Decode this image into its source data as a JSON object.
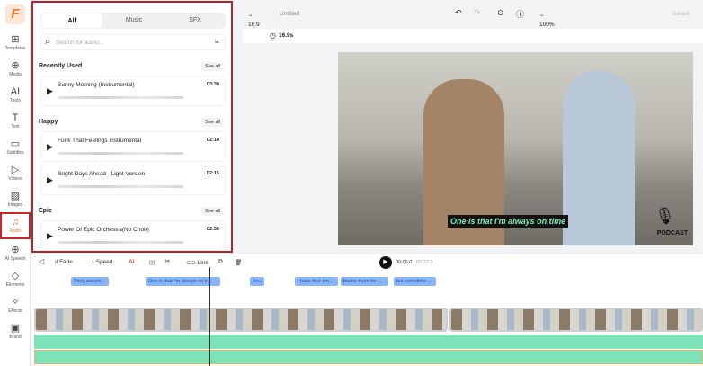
{
  "rail": {
    "logo": "F",
    "items": [
      {
        "label": "Templates",
        "icon": "⊞"
      },
      {
        "label": "Media",
        "icon": "⊕"
      },
      {
        "label": "Tools",
        "icon": "AI"
      },
      {
        "label": "Text",
        "icon": "T"
      },
      {
        "label": "Subtitles",
        "icon": "▭"
      },
      {
        "label": "Videos",
        "icon": "▷"
      },
      {
        "label": "Images",
        "icon": "▨"
      },
      {
        "label": "Audio",
        "icon": "♫"
      },
      {
        "label": "AI Speech",
        "icon": "⊕"
      },
      {
        "label": "Elements",
        "icon": "◇"
      },
      {
        "label": "Effects",
        "icon": "✧"
      },
      {
        "label": "Brand",
        "icon": "▣"
      }
    ]
  },
  "panel": {
    "tabs": [
      "All",
      "Music",
      "SFX"
    ],
    "search_placeholder": "Search for audio...",
    "see_all": "See all",
    "sections": [
      {
        "title": "Recently Used",
        "tracks": [
          {
            "name": "Sunny Morning (Instrumental)",
            "duration": "03:38"
          }
        ]
      },
      {
        "title": "Happy",
        "tracks": [
          {
            "name": "Funk That Feelings Instrumental",
            "duration": "02:10"
          },
          {
            "name": "Bright Days Ahead - Light Version",
            "duration": "02:15"
          }
        ]
      },
      {
        "title": "Epic",
        "tracks": [
          {
            "name": "Power Of Epic Orchestra(No Choir)",
            "duration": "02:56"
          }
        ]
      }
    ]
  },
  "topbar": {
    "ratio": "16:9",
    "title": "Untitled",
    "zoom": "100%",
    "saved": "Saved",
    "duration": "16.9s"
  },
  "video": {
    "caption": "One is that I'm always on time",
    "badge": "PODCAST"
  },
  "timeline": {
    "tools": {
      "fade": "Fade",
      "speed": "Speed",
      "link": "Link"
    },
    "current": "00:06.0",
    "total": "/ 00:33.9",
    "captions": [
      "They assum...",
      "One is that I'm always on ti...",
      "An...",
      "I have four sm...",
      "blame them for ...",
      "but sometime..."
    ]
  }
}
